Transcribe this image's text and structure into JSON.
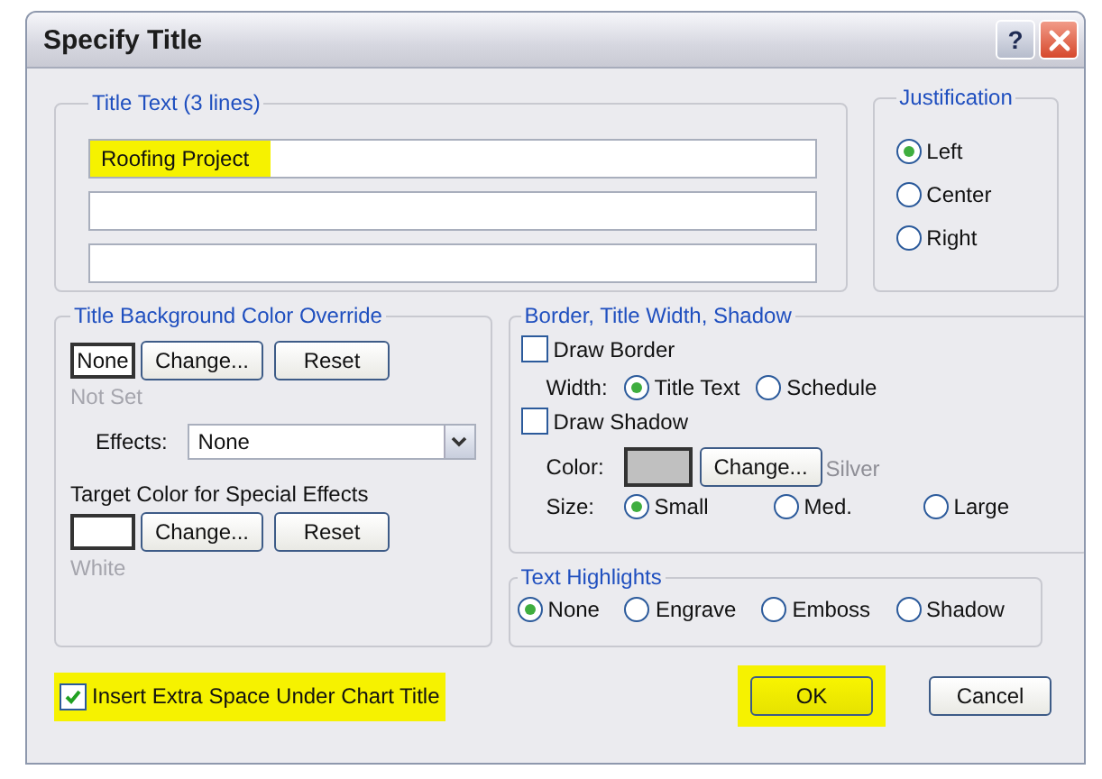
{
  "window": {
    "title": "Specify Title",
    "help": "?"
  },
  "title_text": {
    "legend": "Title Text (3 lines)",
    "lines": [
      {
        "value": "Roofing Project",
        "highlighted": true
      },
      {
        "highlighted": false
      },
      {
        "highlighted": false
      }
    ]
  },
  "justification": {
    "legend": "Justification",
    "options": [
      {
        "label": "Left",
        "selected": true
      },
      {
        "label": "Center",
        "selected": false
      },
      {
        "label": "Right",
        "selected": false
      }
    ]
  },
  "background_override": {
    "legend": "Title Background Color Override",
    "swatch": {
      "text": "None",
      "color": "#ffffff"
    },
    "buttons": [
      "Change...",
      "Reset"
    ],
    "status": "Not Set",
    "effects": {
      "label": "Effects:",
      "value": "None"
    },
    "target": {
      "label": "Target Color for Special Effects",
      "color": "#ffffff",
      "buttons": [
        "Change...",
        "Reset"
      ],
      "status": "White"
    }
  },
  "border": {
    "legend": "Border, Title Width, Shadow",
    "draw_border": {
      "label": "Draw Border",
      "checked": false
    },
    "width": {
      "label": "Width:",
      "options": [
        {
          "label": "Title Text",
          "selected": true
        },
        {
          "label": "Schedule",
          "selected": false
        }
      ]
    },
    "draw_shadow": {
      "label": "Draw Shadow",
      "checked": false
    },
    "color": {
      "label": "Color:",
      "color": "#c0c0c0",
      "button": "Change...",
      "status": "Silver"
    },
    "size": {
      "label": "Size:",
      "options": [
        {
          "label": "Small",
          "selected": true
        },
        {
          "label": "Med.",
          "selected": false
        },
        {
          "label": "Large",
          "selected": false
        }
      ]
    }
  },
  "text_highlights": {
    "legend": "Text Highlights",
    "options": [
      {
        "label": "None",
        "selected": true
      },
      {
        "label": "Engrave",
        "selected": false
      },
      {
        "label": "Emboss",
        "selected": false
      },
      {
        "label": "Shadow",
        "selected": false
      }
    ]
  },
  "extra_space": {
    "label": "Insert Extra Space Under Chart Title",
    "checked": true,
    "highlighted": true
  },
  "actions": [
    {
      "label": "OK",
      "highlighted": true
    },
    {
      "label": "Cancel",
      "highlighted": false
    }
  ]
}
